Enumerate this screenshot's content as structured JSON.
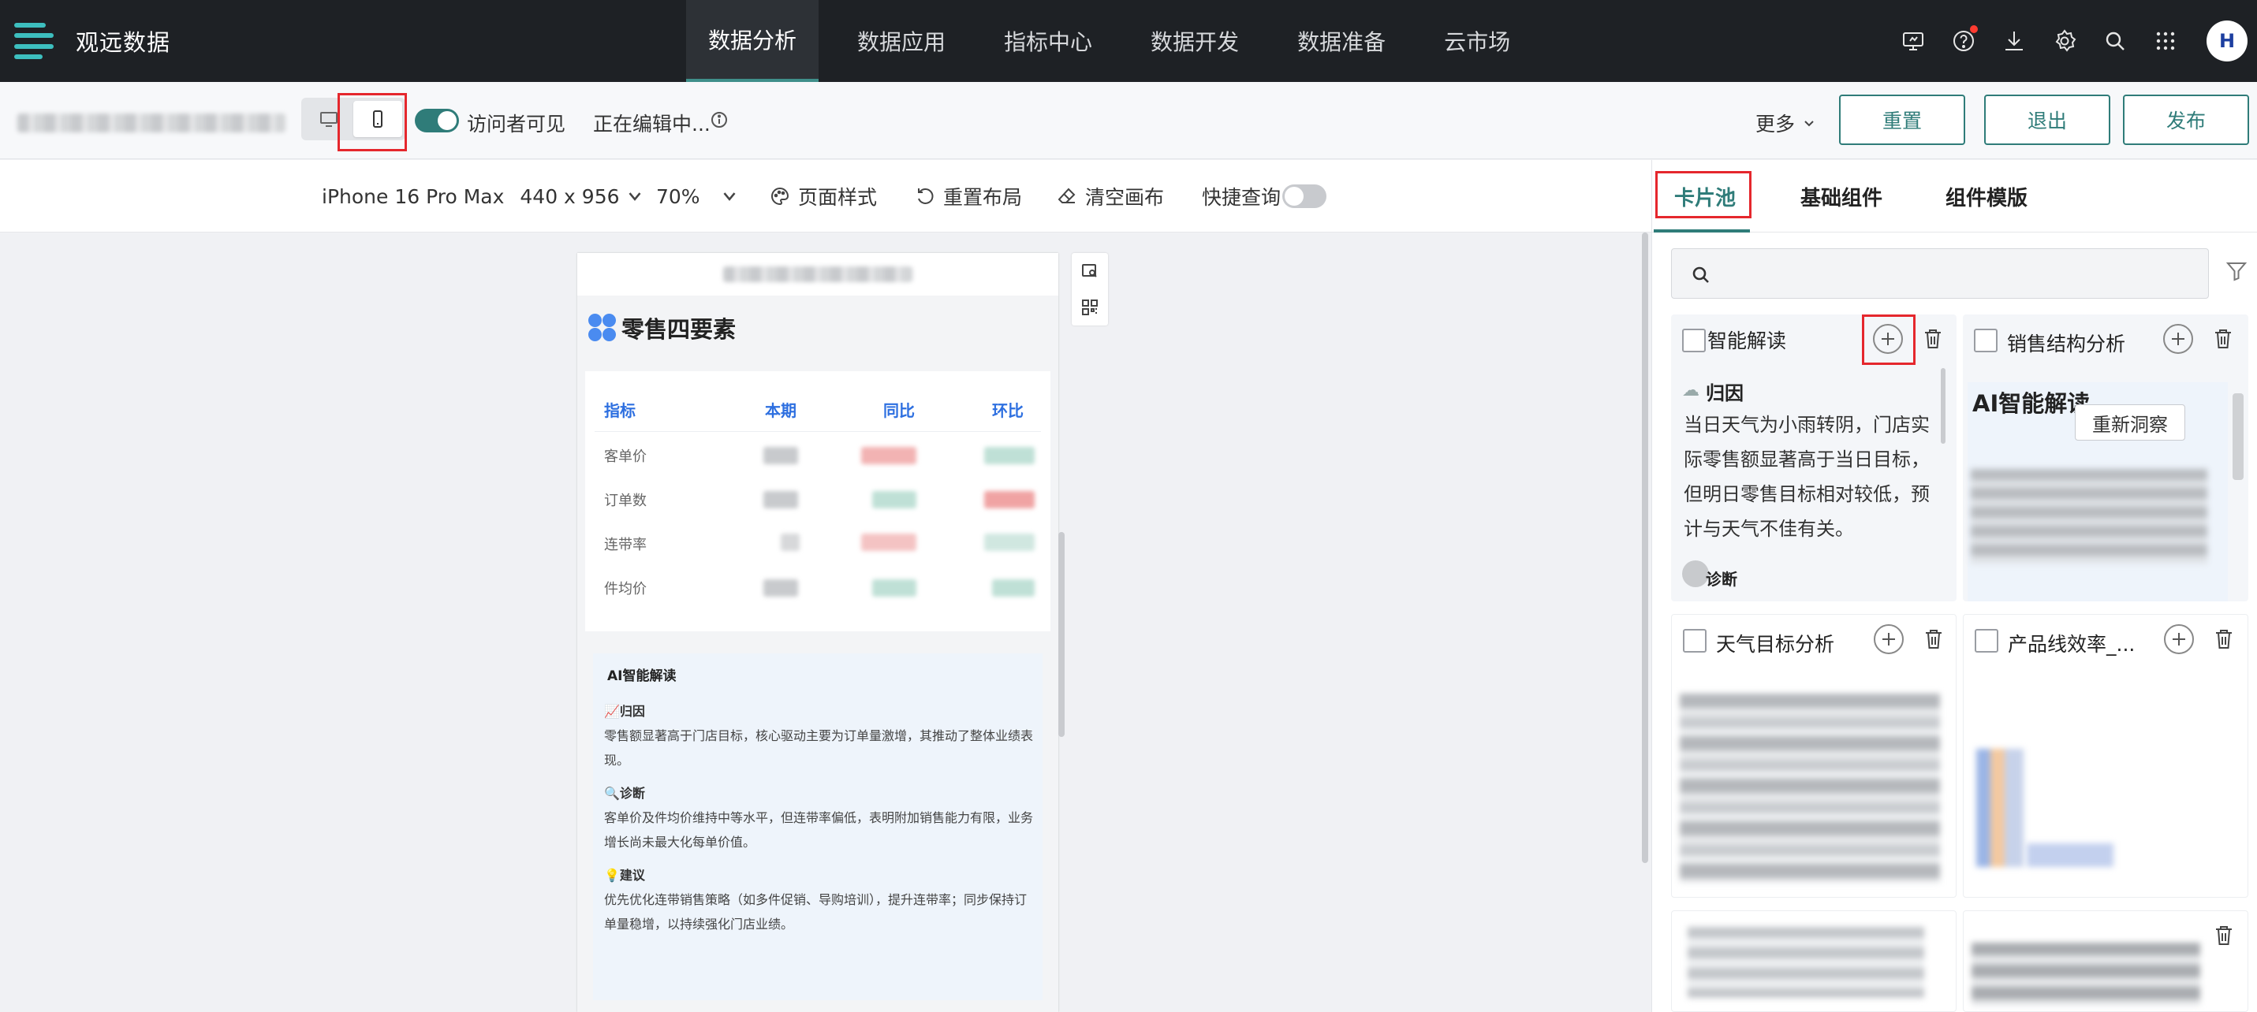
{
  "app": {
    "name": "观远数据"
  },
  "nav": {
    "tabs": [
      "数据分析",
      "数据应用",
      "指标中心",
      "数据开发",
      "数据准备",
      "云市场"
    ],
    "active_tab": "数据分析",
    "icons": [
      "monitor-icon",
      "help-icon",
      "download-icon",
      "settings-icon",
      "search-icon",
      "apps-grid-icon"
    ],
    "avatar_text": "H"
  },
  "toolbar": {
    "visitor_visible_label": "访问者可见",
    "editing_status": "正在编辑中...",
    "more_label": "更多",
    "reset_label": "重置",
    "exit_label": "退出",
    "publish_label": "发布"
  },
  "canvas_toolbar": {
    "device": "iPhone 16 Pro Max",
    "resolution": "440 x 956",
    "zoom": "70%",
    "page_style_label": "页面样式",
    "reset_layout_label": "重置布局",
    "clear_canvas_label": "清空画布",
    "quick_query_label": "快捷查询"
  },
  "phone": {
    "page_title": "零售四要素",
    "kpi_headers": [
      "指标",
      "本期",
      "同比",
      "环比"
    ],
    "kpi_rows": [
      "客单价",
      "订单数",
      "连带率",
      "件均价"
    ],
    "ai_card": {
      "title": "AI智能解读",
      "sections": [
        {
          "label": "📈归因",
          "text": "零售额显著高于门店目标，核心驱动主要为订单量激增，其推动了整体业绩表现。"
        },
        {
          "label": "🔍诊断",
          "text": "客单价及件均价维持中等水平，但连带率偏低，表明附加销售能力有限，业务增长尚未最大化每单价值。"
        },
        {
          "label": "💡建议",
          "text": "优先优化连带销售策略（如多件促销、导购培训），提升连带率；同步保持订单量稳增，以持续强化门店业绩。"
        }
      ]
    }
  },
  "right_panel": {
    "tabs": [
      "卡片池",
      "基础组件",
      "组件模版"
    ],
    "active_tab": "卡片池",
    "search_placeholder": "",
    "cards": [
      {
        "title": "智能解读",
        "section_label": "归因",
        "text": "当日天气为小雨转阴，门店实际零售额显著高于当日目标，但明日零售目标相对较低，预计与天气不佳有关。",
        "footer_label": "诊断"
      },
      {
        "title": "销售结构分析",
        "preview_title": "AI智能解读",
        "button_label": "重新洞察"
      },
      {
        "title": "天气目标分析"
      },
      {
        "title": "产品线效率_..."
      }
    ]
  },
  "colors": {
    "accent": "#2f7c79",
    "nav_bg": "#1e2125",
    "highlight": "#e5272d",
    "kpi_header": "#2d6fe0"
  }
}
